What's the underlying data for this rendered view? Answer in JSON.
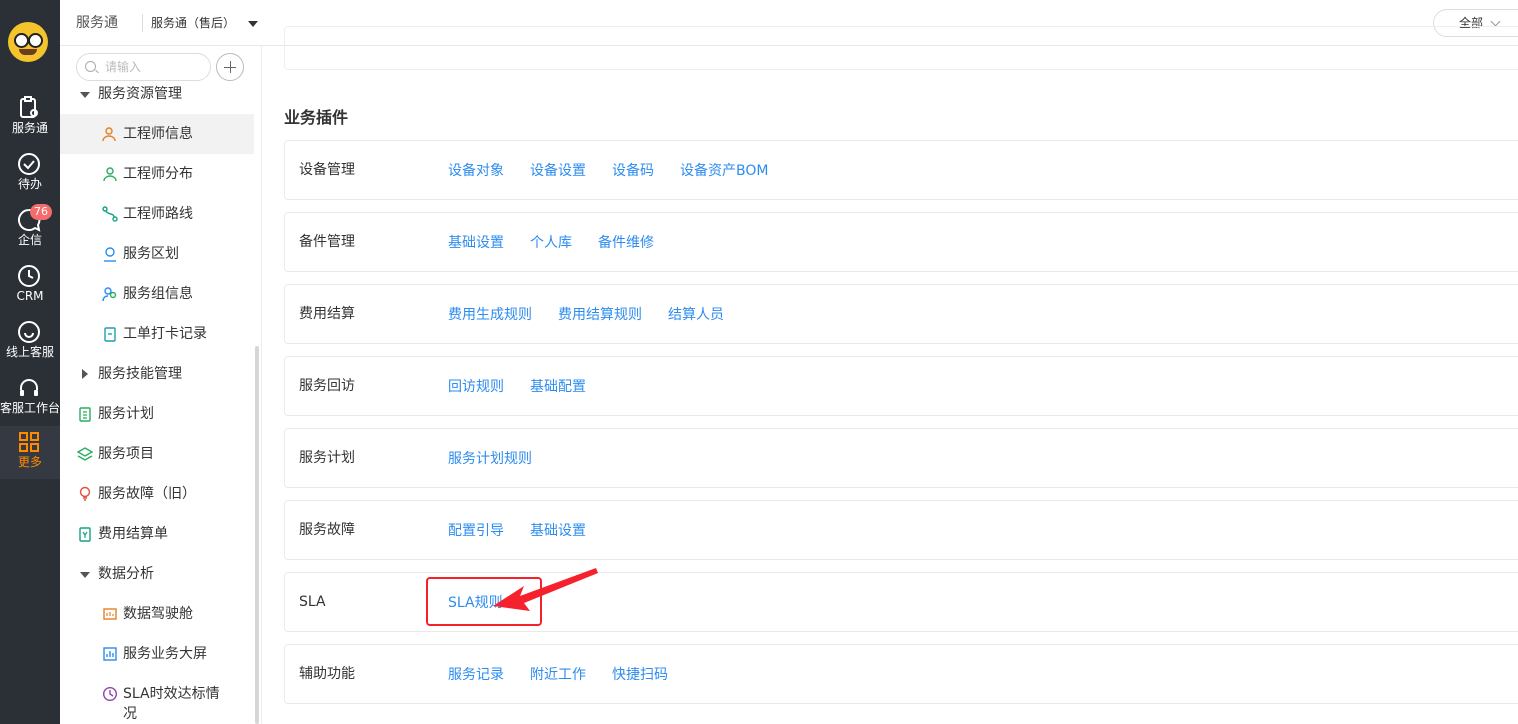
{
  "rail": {
    "items": [
      {
        "label": "服务通",
        "icon": "clipboard-settings-icon"
      },
      {
        "label": "待办",
        "icon": "check-circle-icon"
      },
      {
        "label": "企信",
        "icon": "chat-bubble-icon",
        "badge": "76"
      },
      {
        "label": "CRM",
        "icon": "clock-icon"
      },
      {
        "label": "线上客服",
        "icon": "smile-chat-icon"
      },
      {
        "label": "客服工作台",
        "icon": "headset-icon"
      },
      {
        "label": "更多",
        "icon": "grid-icon",
        "active": true
      }
    ]
  },
  "header": {
    "app_title": "服务通",
    "app_select": "服务通（售后）",
    "scope": "全部"
  },
  "sidebar": {
    "search_placeholder": "请输入",
    "items": [
      {
        "label": "服务资源管理",
        "level": 0,
        "expand": "down"
      },
      {
        "label": "工程师信息",
        "level": 1,
        "selected": true,
        "icon": "engineer-icon"
      },
      {
        "label": "工程师分布",
        "level": 1,
        "icon": "location-person-icon"
      },
      {
        "label": "工程师路线",
        "level": 1,
        "icon": "route-icon"
      },
      {
        "label": "服务区划",
        "level": 1,
        "icon": "region-icon"
      },
      {
        "label": "服务组信息",
        "level": 1,
        "icon": "group-icon"
      },
      {
        "label": "工单打卡记录",
        "level": 1,
        "icon": "checkin-icon"
      },
      {
        "label": "服务技能管理",
        "level": 0,
        "expand": "right"
      },
      {
        "label": "服务计划",
        "level": 0,
        "icon": "plan-icon"
      },
      {
        "label": "服务项目",
        "level": 0,
        "icon": "layers-icon"
      },
      {
        "label": "服务故障（旧）",
        "level": 0,
        "icon": "bulb-icon"
      },
      {
        "label": "费用结算单",
        "level": 0,
        "icon": "invoice-icon"
      },
      {
        "label": "数据分析",
        "level": 0,
        "expand": "down"
      },
      {
        "label": "数据驾驶舱",
        "level": 1,
        "icon": "dashboard-icon"
      },
      {
        "label": "服务业务大屏",
        "level": 1,
        "icon": "bar-chart-icon"
      },
      {
        "label": "SLA时效达标情况",
        "level": 1,
        "icon": "clock-icon"
      }
    ]
  },
  "main": {
    "section_title": "业务插件",
    "rows": [
      {
        "name": "设备管理",
        "links": [
          "设备对象",
          "设备设置",
          "设备码",
          "设备资产BOM"
        ]
      },
      {
        "name": "备件管理",
        "links": [
          "基础设置",
          "个人库",
          "备件维修"
        ]
      },
      {
        "name": "费用结算",
        "links": [
          "费用生成规则",
          "费用结算规则",
          "结算人员"
        ]
      },
      {
        "name": "服务回访",
        "links": [
          "回访规则",
          "基础配置"
        ]
      },
      {
        "name": "服务计划",
        "links": [
          "服务计划规则"
        ]
      },
      {
        "name": "服务故障",
        "links": [
          "配置引导",
          "基础设置"
        ]
      },
      {
        "name": "SLA",
        "links": [
          "SLA规则"
        ]
      },
      {
        "name": "辅助功能",
        "links": [
          "服务记录",
          "附近工作",
          "快捷扫码"
        ]
      }
    ]
  },
  "colors": {
    "link": "#2d8cf0",
    "highlight": "#f5222d",
    "rail_bg": "#2b2f36",
    "active": "#ff8a00"
  }
}
